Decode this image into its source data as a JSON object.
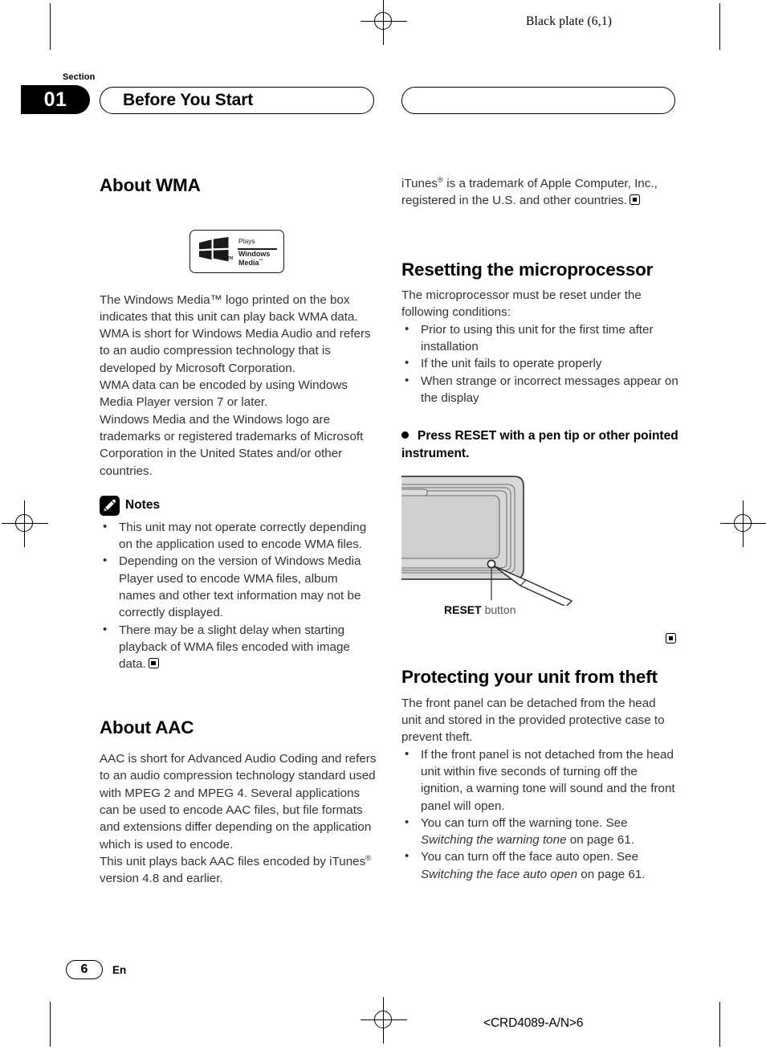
{
  "print_marks": {
    "black_plate": "Black plate (6,1)",
    "part_number": "<CRD4089-A/N>6"
  },
  "header": {
    "section_label": "Section",
    "section_number": "01",
    "chapter_title": "Before You Start"
  },
  "left_column": {
    "wma": {
      "heading": "About WMA",
      "logo": {
        "plays": "Plays",
        "line1": "Windows",
        "line2": "Media",
        "tm": "TM"
      },
      "paragraphs": [
        "The Windows Media™ logo printed on the box indicates that this unit can play back WMA data.",
        "WMA is short for Windows Media Audio and refers to an audio compression technology that is developed by Microsoft Corporation.",
        "WMA data can be encoded by using Windows Media Player version 7 or later.",
        "Windows Media and the Windows logo are trademarks or registered trademarks of Microsoft Corporation in the United States and/or other countries."
      ],
      "notes_label": "Notes",
      "notes": [
        "This unit may not operate correctly depending on the application used to encode WMA files.",
        "Depending on the version of Windows Media Player used to encode WMA files, album names and other text information may not be correctly displayed.",
        "There may be a slight delay when starting playback of WMA files encoded with image data."
      ]
    },
    "aac": {
      "heading": "About AAC",
      "paragraphs": [
        "AAC is short for Advanced Audio Coding and refers to an audio compression technology standard used with MPEG 2 and MPEG 4. Several applications can be used to encode AAC files, but file formats and extensions differ depending on the application which is used to encode.",
        "This unit plays back AAC files encoded by iTunes® version 4.8 and earlier."
      ]
    }
  },
  "right_column": {
    "itunes_trademark": "iTunes® is a trademark of Apple Computer, Inc., registered in the U.S. and other countries.",
    "reset": {
      "heading": "Resetting the microprocessor",
      "intro": "The microprocessor must be reset under the following conditions:",
      "conditions": [
        "Prior to using this unit for the first time after installation",
        "If the unit fails to operate properly",
        "When strange or incorrect messages appear on the display"
      ],
      "instruction": "Press RESET with a pen tip or other pointed instrument.",
      "figure_caption_bold": "RESET",
      "figure_caption_rest": " button"
    },
    "theft": {
      "heading": "Protecting your unit from theft",
      "intro": "The front panel can be detached from the head unit and stored in the provided protective case to prevent theft.",
      "bullets": [
        {
          "text": "If the front panel is not detached from the head unit within five seconds of turning off the ignition, a warning tone will sound and the front panel will open."
        },
        {
          "pre": "You can turn off the warning tone. See ",
          "italic": "Switching the warning tone",
          "post": " on page 61."
        },
        {
          "pre": "You can turn off the face auto open. See ",
          "italic": "Switching the face auto open",
          "post": " on page 61."
        }
      ]
    }
  },
  "footer": {
    "page_number": "6",
    "language": "En"
  }
}
